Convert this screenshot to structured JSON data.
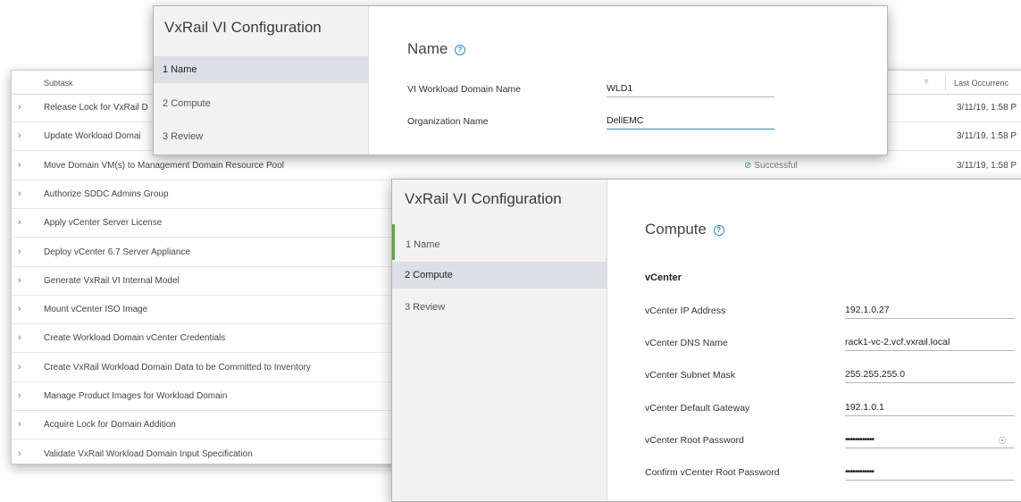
{
  "table": {
    "header": {
      "subtask": "Subtask",
      "last_occurrence": "Last Occurrenc",
      "filter_icon": "filter-icon"
    },
    "rows": [
      {
        "label": "Release Lock for VxRail D",
        "status": "",
        "date": "3/11/19, 1:58 P"
      },
      {
        "label": "Update Workload Domai",
        "status": "",
        "date": "3/11/19, 1:58 P"
      },
      {
        "label": "Move Domain VM(s) to Management Domain Resource Pool",
        "status": "Successful",
        "date": "3/11/19, 1:58 P"
      },
      {
        "label": "Authorize SDDC Admins Group",
        "status": "",
        "date": ""
      },
      {
        "label": "Apply vCenter Server License",
        "status": "",
        "date": ""
      },
      {
        "label": "Deploy vCenter 6.7 Server Appliance",
        "status": "",
        "date": ""
      },
      {
        "label": "Generate VxRail VI Internal Model",
        "status": "",
        "date": ""
      },
      {
        "label": "Mount vCenter ISO Image",
        "status": "",
        "date": ""
      },
      {
        "label": "Create Workload Domain vCenter Credentials",
        "status": "",
        "date": ""
      },
      {
        "label": "Create VxRail Workload Domain Data to be Committed to Inventory",
        "status": "",
        "date": ""
      },
      {
        "label": "Manage Product Images for Workload Domain",
        "status": "",
        "date": ""
      },
      {
        "label": "Acquire Lock for Domain Addition",
        "status": "",
        "date": ""
      },
      {
        "label": "Validate VxRail Workload Domain Input Specification",
        "status": "",
        "date": ""
      }
    ]
  },
  "dialog_name": {
    "title": "VxRail VI Configuration",
    "steps": [
      "1 Name",
      "2 Compute",
      "3 Review"
    ],
    "active_step": 0,
    "heading": "Name",
    "fields": [
      {
        "label": "VI Workload Domain Name",
        "value": "WLD1"
      },
      {
        "label": "Organization Name",
        "value": "DellEMC"
      }
    ]
  },
  "dialog_compute": {
    "title": "VxRail VI Configuration",
    "steps": [
      "1 Name",
      "2 Compute",
      "3 Review"
    ],
    "active_step": 1,
    "heading": "Compute",
    "section": "vCenter",
    "fields": [
      {
        "label": "vCenter IP Address",
        "value": "192.1.0.27"
      },
      {
        "label": "vCenter DNS Name",
        "value": "rack1-vc-2.vcf.vxrail.local"
      },
      {
        "label": "vCenter Subnet Mask",
        "value": "255.255.255.0"
      },
      {
        "label": "vCenter Default Gateway",
        "value": "192.1.0.1"
      },
      {
        "label": "vCenter Root Password",
        "value": "••••••••••••"
      },
      {
        "label": "Confirm vCenter Root Password",
        "value": "••••••••••••"
      }
    ]
  },
  "icons": {
    "help": "help-icon",
    "chevron": "chevron-right-icon",
    "success": "check-circle-icon",
    "eye": "eye-icon"
  },
  "colors": {
    "accent": "#2c8ccf",
    "success": "#4aa64a",
    "active_step_bg": "#dcdfe3"
  }
}
